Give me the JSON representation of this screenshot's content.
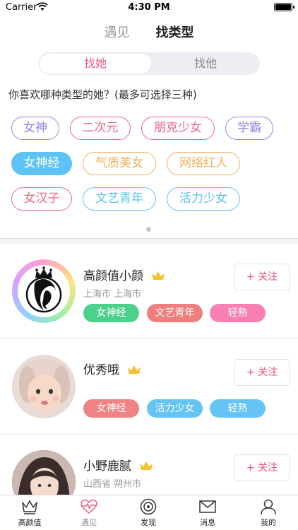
{
  "status_bar": {
    "carrier": "Carrier",
    "time": "4:30 PM"
  },
  "top_tabs": [
    {
      "label": "遇见"
    },
    {
      "label": "找类型"
    }
  ],
  "segment": {
    "left": "找她",
    "right": "找他"
  },
  "question": "你喜欢哪种类型的她？(最多可选择三种)",
  "chips": [
    {
      "label": "女神",
      "color": "#8e86e6",
      "selected": false
    },
    {
      "label": "二次元",
      "color": "#ec6a86",
      "selected": false
    },
    {
      "label": "朋克少女",
      "color": "#ec6a86",
      "selected": false
    },
    {
      "label": "学霸",
      "color": "#8e86e6",
      "selected": false
    },
    {
      "label": "女神经",
      "color": "#5ec2f4",
      "selected": true
    },
    {
      "label": "气质美女",
      "color": "#f0b25c",
      "selected": false
    },
    {
      "label": "网络红人",
      "color": "#f0b25c",
      "selected": false
    },
    {
      "label": "女汉子",
      "color": "#ec6a86",
      "selected": false
    },
    {
      "label": "文艺青年",
      "color": "#5ec2f4",
      "selected": false
    },
    {
      "label": "活力少女",
      "color": "#5ec2f4",
      "selected": false
    }
  ],
  "users": [
    {
      "name": "高颜值小颜",
      "location": "上海市 上海市",
      "follow_label": "+ 关注",
      "tags": [
        {
          "label": "女神经",
          "color": "#4cd08c"
        },
        {
          "label": "文艺青年",
          "color": "#ef7f7f"
        },
        {
          "label": "轻熟",
          "color": "#f77fb2"
        }
      ]
    },
    {
      "name": "优秀哦",
      "location": "",
      "follow_label": "+ 关注",
      "tags": [
        {
          "label": "女神经",
          "color": "#ef8383"
        },
        {
          "label": "活力少女",
          "color": "#66c4f5"
        },
        {
          "label": "轻熟",
          "color": "#66c4f5"
        }
      ]
    },
    {
      "name": "小野鹿腻",
      "location": "山西省 朔州市",
      "follow_label": "+ 关注",
      "tags": []
    }
  ],
  "tabbar": [
    {
      "label": "高颜值",
      "icon": "crown-icon"
    },
    {
      "label": "遇见",
      "icon": "heart-pulse-icon"
    },
    {
      "label": "发现",
      "icon": "radar-icon"
    },
    {
      "label": "消息",
      "icon": "envelope-icon"
    },
    {
      "label": "我的",
      "icon": "person-icon"
    }
  ],
  "colors": {
    "accent": "#ec5d82",
    "crown": "#f2c230"
  }
}
